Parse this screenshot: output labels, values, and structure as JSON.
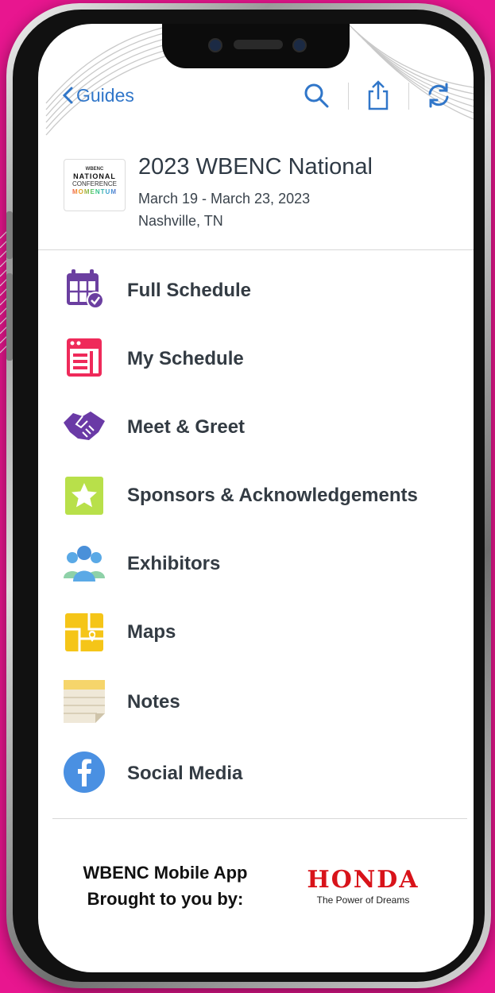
{
  "nav": {
    "back_label": "Guides",
    "icons": [
      "search-icon",
      "share-icon",
      "refresh-icon"
    ]
  },
  "event": {
    "title": "2023 WBENC National",
    "dates": "March 19 - March 23, 2023",
    "location": "Nashville, TN",
    "logo": {
      "line1": "WBENC",
      "line2": "NATIONAL",
      "line3": "CONFERENCE",
      "line4": "MOMENTUM"
    }
  },
  "menu": {
    "items": [
      {
        "label": "Full Schedule",
        "icon": "calendar-check-icon",
        "color": "#6b3fa0"
      },
      {
        "label": "My Schedule",
        "icon": "schedule-list-icon",
        "color": "#ef2a5a"
      },
      {
        "label": "Meet & Greet",
        "icon": "handshake-icon",
        "color": "#6a3aa6"
      },
      {
        "label": "Sponsors & Acknowledgements",
        "icon": "star-icon",
        "color": "#b8e04a"
      },
      {
        "label": "Exhibitors",
        "icon": "people-icon",
        "color": "#5aa9e6"
      },
      {
        "label": "Maps",
        "icon": "map-icon",
        "color": "#f5c518"
      },
      {
        "label": "Notes",
        "icon": "notepad-icon",
        "color": "#f6d56b"
      },
      {
        "label": "Social Media",
        "icon": "facebook-icon",
        "color": "#4a90e2"
      }
    ]
  },
  "footer": {
    "sponsor_line1": "WBENC Mobile App",
    "sponsor_line2": "Brought to you by:",
    "brand": "HONDA",
    "tagline": "The Power of Dreams"
  },
  "colors": {
    "background": "#e8168f",
    "link": "#3076c9",
    "text": "#333b43"
  }
}
